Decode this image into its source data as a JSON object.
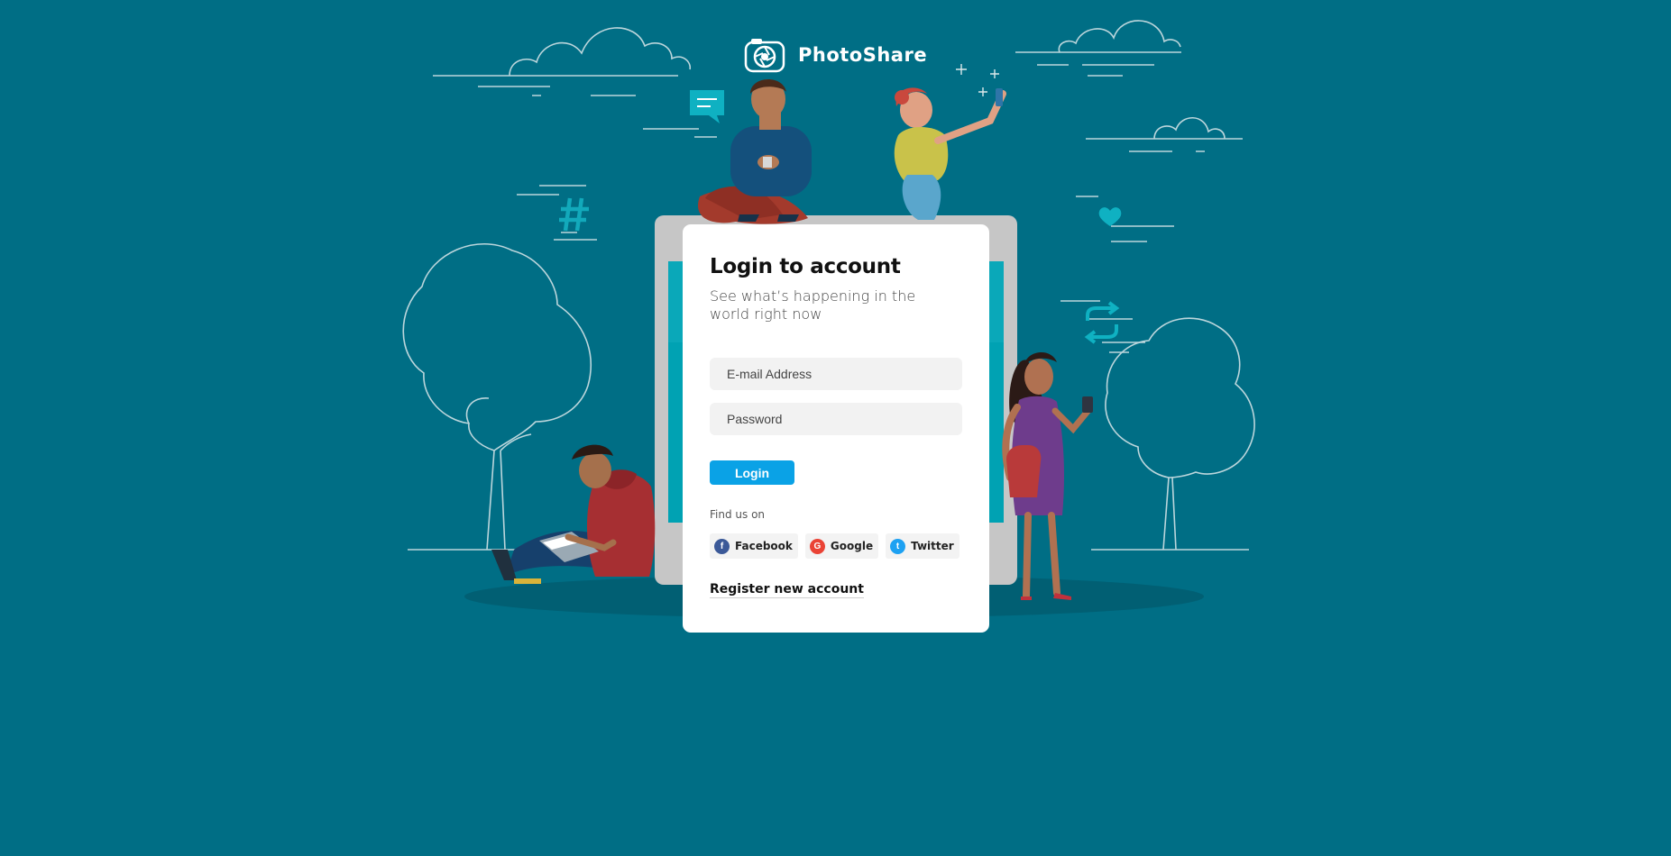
{
  "brand": {
    "name": "PhotoShare",
    "logo_icon": "camera-aperture-icon"
  },
  "login_card": {
    "title": "Login to account",
    "subtitle": "See what’s happening in the world right now",
    "email_placeholder": "E-mail Address",
    "password_placeholder": "Password",
    "login_label": "Login",
    "find_us_label": "Find us on",
    "social": [
      {
        "label": "Facebook",
        "icon": "facebook-icon",
        "color": "#3b5998",
        "glyph": "f"
      },
      {
        "label": "Google",
        "icon": "google-icon",
        "color": "#ea4335",
        "glyph": "G"
      },
      {
        "label": "Twitter",
        "icon": "twitter-icon",
        "color": "#1da1f2",
        "glyph": "t"
      }
    ],
    "register_label": "Register new account"
  },
  "colors": {
    "background": "#006e85",
    "accent": "#0aa2e6",
    "illustration_teal": "#00a2b3"
  },
  "illustration": {
    "decor_icons": [
      "chat-bubble-icon",
      "hashtag-icon",
      "heart-icon",
      "retweet-icon",
      "sparkle-icon"
    ]
  }
}
